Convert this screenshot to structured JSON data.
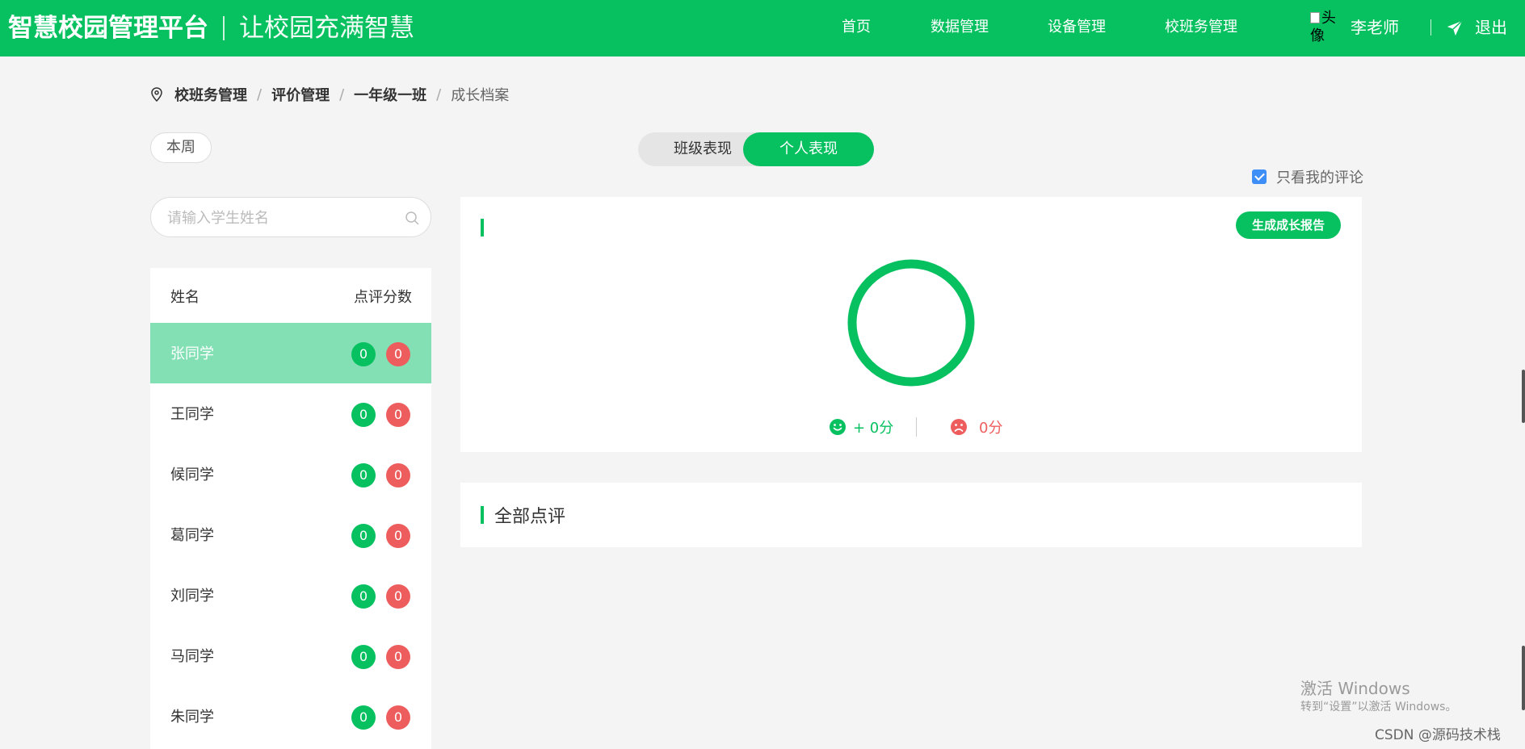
{
  "header": {
    "brand": "智慧校园管理平台",
    "slogan": "让校园充满智慧",
    "nav": [
      "首页",
      "数据管理",
      "设备管理",
      "校班务管理"
    ],
    "avatar_alt": "头像",
    "username": "李老师",
    "logout": "退出",
    "bg_color": "#07c160"
  },
  "breadcrumb": {
    "items": [
      "校班务管理",
      "评价管理",
      "一年级一班"
    ],
    "current": "成长档案",
    "separator": "/"
  },
  "filters": {
    "week": "本周",
    "toggle": {
      "class_label": "班级表现",
      "personal_label": "个人表现",
      "selected": "个人表现"
    },
    "only_mine": {
      "label": "只看我的评论",
      "checked": true
    }
  },
  "search": {
    "placeholder": "请输入学生姓名",
    "value": ""
  },
  "student_list": {
    "col_name": "姓名",
    "col_score": "点评分数",
    "selected": "张同学",
    "rows": [
      {
        "name": "张同学",
        "positive": "0",
        "negative": "0"
      },
      {
        "name": "王同学",
        "positive": "0",
        "negative": "0"
      },
      {
        "name": "候同学",
        "positive": "0",
        "negative": "0"
      },
      {
        "name": "葛同学",
        "positive": "0",
        "negative": "0"
      },
      {
        "name": "刘同学",
        "positive": "0",
        "negative": "0"
      },
      {
        "name": "马同学",
        "positive": "0",
        "negative": "0"
      },
      {
        "name": "朱同学",
        "positive": "0",
        "negative": "0"
      }
    ]
  },
  "overview": {
    "report_button": "生成成长报告",
    "positive_score": "+ 0分",
    "negative_score": "0分",
    "positive_color": "#07c160",
    "negative_color": "#ee5d5d"
  },
  "comments": {
    "title": "全部点评"
  },
  "watermark": {
    "windows_line1": "激活 Windows",
    "windows_line2": "转到“设置”以激活 Windows。",
    "csdn": "CSDN @源码技术栈"
  }
}
